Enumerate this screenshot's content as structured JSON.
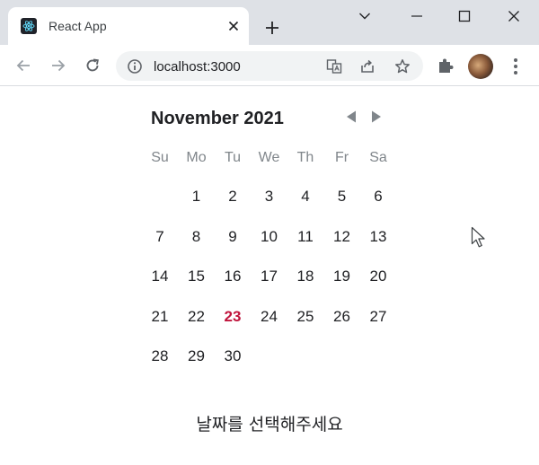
{
  "browser": {
    "tab_title": "React App",
    "url": "localhost:3000"
  },
  "calendar": {
    "month_label": "November 2021",
    "weekdays": [
      "Su",
      "Mo",
      "Tu",
      "We",
      "Th",
      "Fr",
      "Sa"
    ],
    "weeks": [
      [
        "",
        "1",
        "2",
        "3",
        "4",
        "5",
        "6"
      ],
      [
        "7",
        "8",
        "9",
        "10",
        "11",
        "12",
        "13"
      ],
      [
        "14",
        "15",
        "16",
        "17",
        "18",
        "19",
        "20"
      ],
      [
        "21",
        "22",
        "23",
        "24",
        "25",
        "26",
        "27"
      ],
      [
        "28",
        "29",
        "30",
        "",
        "",
        "",
        ""
      ]
    ],
    "today": "23",
    "today_color": "#c0143c"
  },
  "page": {
    "prompt": "날짜를 선택해주세요"
  },
  "icons": {
    "favicon": "react-logo-icon",
    "tab_close": "close-icon",
    "new_tab": "plus-icon",
    "back": "arrow-left-icon",
    "forward": "arrow-right-icon",
    "reload": "reload-icon",
    "site_info": "info-icon",
    "translate": "translate-icon",
    "share": "share-icon",
    "bookmark": "star-icon",
    "extensions": "puzzle-icon",
    "menu": "kebab-menu-icon",
    "prev_month": "triangle-left-icon",
    "next_month": "triangle-right-icon"
  }
}
